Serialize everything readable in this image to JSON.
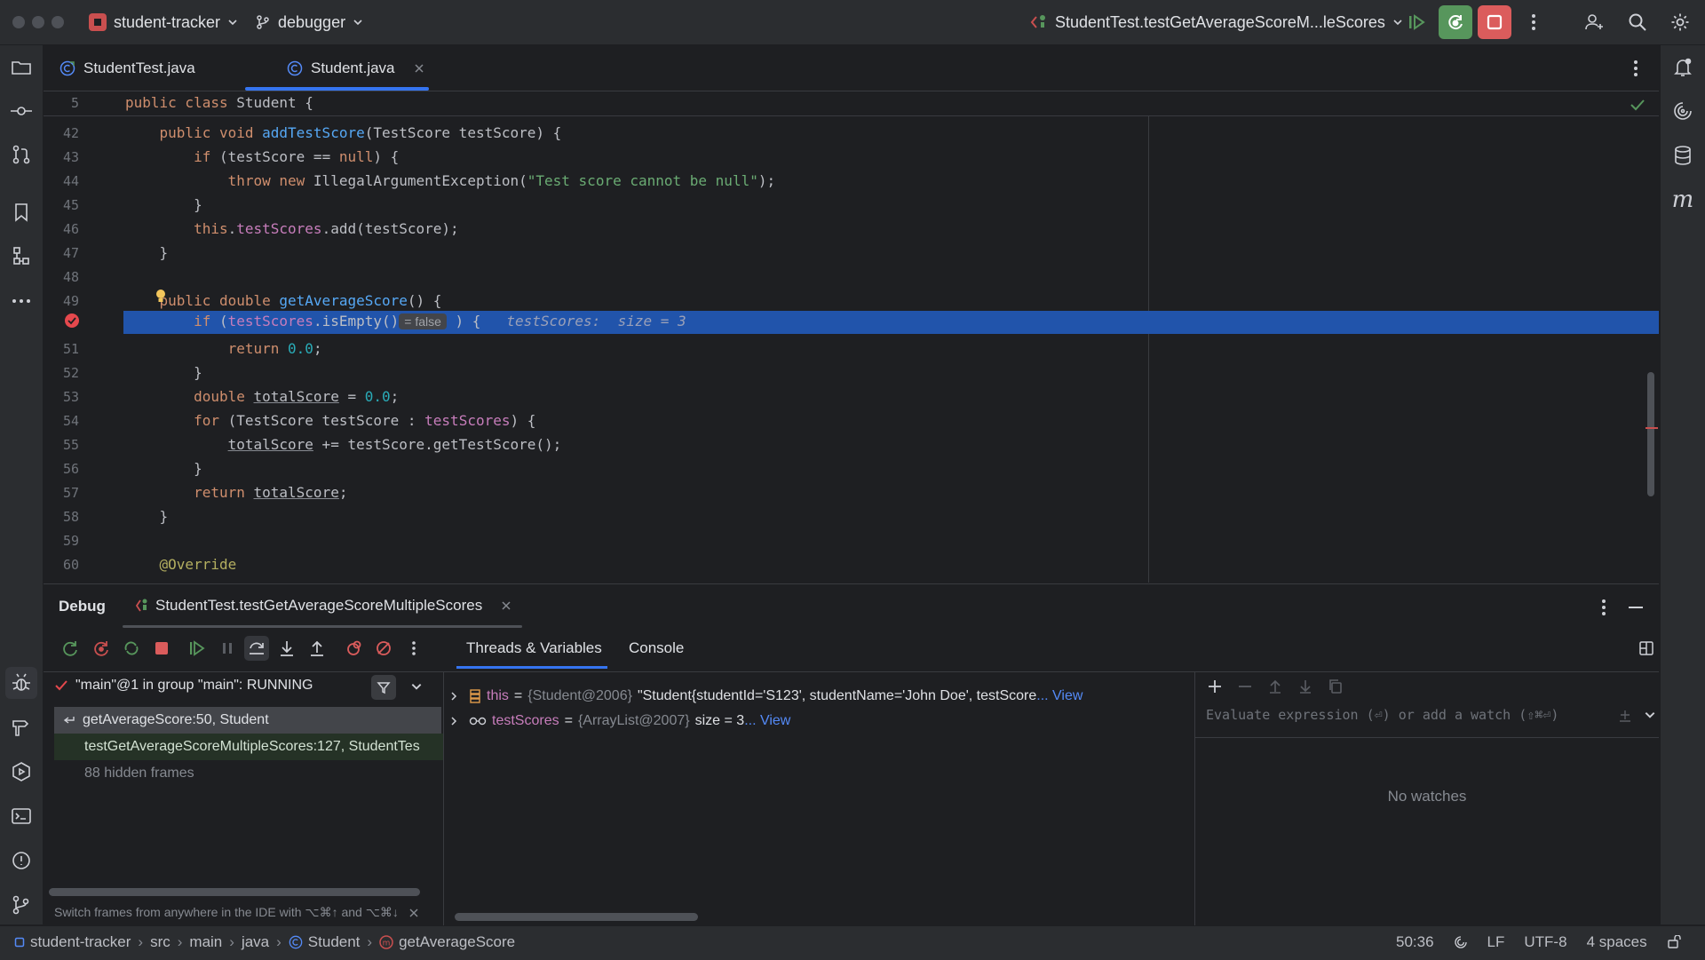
{
  "titlebar": {
    "project": "student-tracker",
    "branch": "debugger",
    "run_config": "StudentTest.testGetAverageScoreM...leScores"
  },
  "tabs": [
    {
      "label": "StudentTest.java"
    },
    {
      "label": "Student.java"
    }
  ],
  "editor": {
    "sticky_line": {
      "num": "5",
      "text": "public class Student {"
    },
    "lines": [
      {
        "num": "42"
      },
      {
        "num": "43"
      },
      {
        "num": "44"
      },
      {
        "num": "45"
      },
      {
        "num": "46"
      },
      {
        "num": "47"
      },
      {
        "num": "48"
      },
      {
        "num": "49"
      },
      {
        "num": "50"
      },
      {
        "num": "51"
      },
      {
        "num": "52"
      },
      {
        "num": "53"
      },
      {
        "num": "54"
      },
      {
        "num": "55"
      },
      {
        "num": "56"
      },
      {
        "num": "57"
      },
      {
        "num": "58"
      },
      {
        "num": "59"
      },
      {
        "num": "60"
      }
    ],
    "inlay_false": "= false",
    "debug_hint": "testScores:  size = 3"
  },
  "debug": {
    "title": "Debug",
    "session": "StudentTest.testGetAverageScoreMultipleScores",
    "thread": "\"main\"@1 in group \"main\": RUNNING",
    "frames": [
      "getAverageScore:50, Student",
      "testGetAverageScoreMultipleScores:127, StudentTes",
      "88 hidden frames"
    ],
    "tabs": [
      "Threads & Variables",
      "Console"
    ],
    "vars": [
      {
        "name": "this",
        "eq": "=",
        "type": "{Student@2006}",
        "value": "\"Student{studentId='S123', studentName='John Doe', testScore",
        "link": "... View"
      },
      {
        "name": "testScores",
        "eq": "=",
        "type": "{ArrayList@2007}",
        "value": "size = 3",
        "link": "... View"
      }
    ],
    "watch_placeholder": "Evaluate expression (⏎) or add a watch (⇧⌘⏎)",
    "no_watches": "No watches",
    "frames_hint": "Switch frames from anywhere in the IDE with ⌥⌘↑ and ⌥⌘↓"
  },
  "statusbar": {
    "breadcrumbs": [
      "student-tracker",
      "src",
      "main",
      "java",
      "Student",
      "getAverageScore"
    ],
    "position": "50:36",
    "line_sep": "LF",
    "encoding": "UTF-8",
    "indent": "4 spaces"
  },
  "colors": {
    "accent": "#3574f0",
    "exec_line": "#2154ab",
    "breakpoint": "#e5484d",
    "run_green": "#57965c",
    "stop_red": "#db5c5c"
  }
}
